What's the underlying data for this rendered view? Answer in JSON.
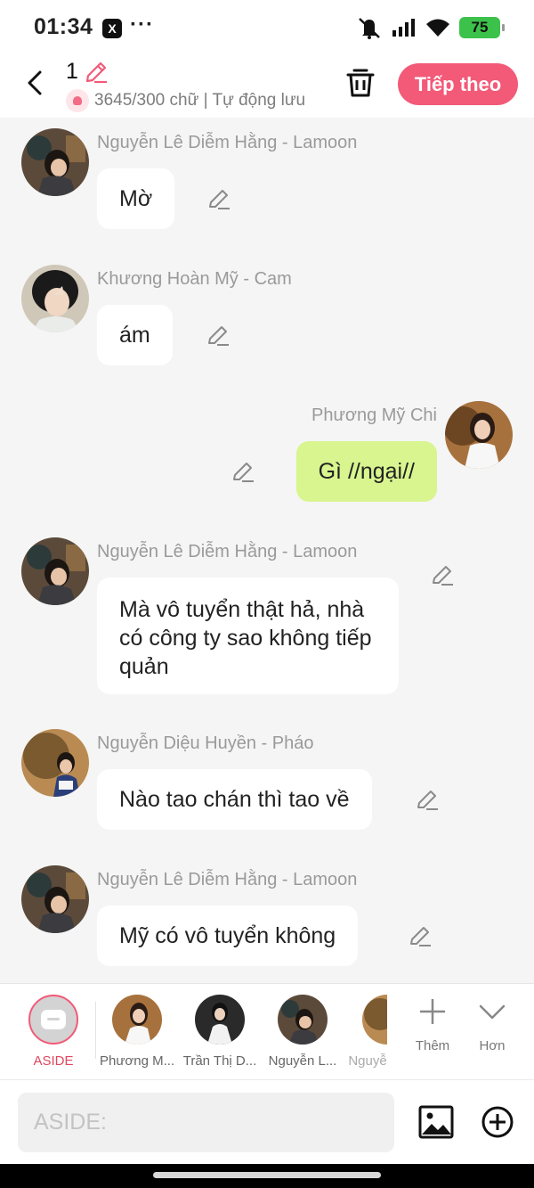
{
  "status_bar": {
    "time": "01:34",
    "app_icon": "X",
    "more": "···",
    "battery": "75"
  },
  "header": {
    "title": "1",
    "subtitle": "3645/300 chữ | Tự động lưu",
    "next_label": "Tiếp theo"
  },
  "messages": [
    {
      "sender": "Nguyễn Lê Diễm Hằng - Lamoon",
      "text": "Mờ",
      "mine": false
    },
    {
      "sender": "Khương Hoàn Mỹ - Cam",
      "text": "ám",
      "mine": false
    },
    {
      "sender": "Phương Mỹ Chi",
      "text": "Gì //ngại//",
      "mine": true
    },
    {
      "sender": "Nguyễn Lê Diễm Hằng - Lamoon",
      "text": "Mà vô tuyển thật hả, nhà có công ty sao không tiếp quản",
      "mine": false
    },
    {
      "sender": "Nguyễn Diệu Huyền - Pháo",
      "text": "Nào tao chán thì tao về",
      "mine": false
    },
    {
      "sender": "Nguyễn Lê Diễm Hằng - Lamoon",
      "text": "Mỹ có vô tuyển không",
      "mine": false
    }
  ],
  "characters": {
    "aside_label": "ASIDE",
    "items": [
      "Phương M...",
      "Trần Thị D...",
      "Nguyễn L...",
      "Nguyễ"
    ],
    "add_label": "Thêm",
    "more_label": "Hơn"
  },
  "input": {
    "placeholder": "ASIDE:"
  },
  "colors": {
    "accent": "#f25a78",
    "mine_bubble": "#d8f58f",
    "background": "#f5f5f5"
  }
}
